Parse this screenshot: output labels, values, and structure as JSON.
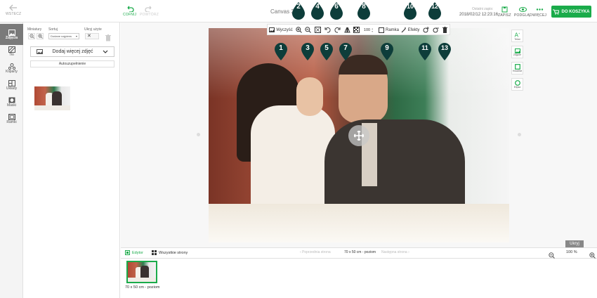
{
  "topbar": {
    "back_label": "WSTECZ",
    "undo_label": "COFNIJ",
    "redo_label": "POWTÓRZ",
    "title": "Canvas 3D",
    "last_saved_label": "Ostatni zapis:",
    "last_saved_value": "2018/02/12 12:23:16",
    "save_label": "ZAPISZ",
    "preview_label": "PODGLĄD",
    "more_label": "WIĘCEJ",
    "cart_label": "DO KOSZYKA",
    "accent": "#1aab4a"
  },
  "leftnav": [
    {
      "label": "Zdjęcia",
      "icon": "photo-icon",
      "active": true
    },
    {
      "label": "Tło",
      "icon": "background-icon",
      "active": false
    },
    {
      "label": "Kliparty",
      "icon": "clipart-icon",
      "active": false
    },
    {
      "label": "Układy",
      "icon": "layout-icon",
      "active": false
    },
    {
      "label": "Maski",
      "icon": "mask-icon",
      "active": false
    },
    {
      "label": "Ramki",
      "icon": "frame-icon",
      "active": false
    }
  ],
  "panel": {
    "thumbnails_label": "Miniatury",
    "sort_label": "Sortuj",
    "sort_value": "Dodane najpierw",
    "hide_used_label": "Ukryj użyte",
    "add_photos_label": "Dodaj więcej zdjęć",
    "autofill_label": "Autouzupełnienie"
  },
  "toolbar": {
    "clear_label": "Wyczyść",
    "zoom_value": "100",
    "frame_label": "Ramka",
    "effects_label": "Efekty"
  },
  "pins": [
    "1",
    "2",
    "3",
    "4",
    "5",
    "6",
    "7",
    "8",
    "9",
    "10",
    "11",
    "12",
    "13"
  ],
  "right_tools": [
    {
      "label": "Tekst",
      "icon": "text-icon"
    },
    {
      "label": "Zdjęcie",
      "icon": "image-icon"
    },
    {
      "label": "Kwadrat",
      "icon": "square-icon"
    },
    {
      "label": "Elipsa",
      "icon": "ellipse-icon"
    }
  ],
  "canvas": {
    "hide_label": "Ukryj"
  },
  "bottombar": {
    "editor_label": "Edytor",
    "all_pages_label": "Wszystkie strony",
    "prev_label": "Poprzednia strona",
    "page_label": "70 x 50 cm - poziom",
    "next_label": "Następna strona",
    "zoom_value": "100 %"
  },
  "thumbs": [
    {
      "label": "70 x 50 cm - poziom"
    }
  ]
}
